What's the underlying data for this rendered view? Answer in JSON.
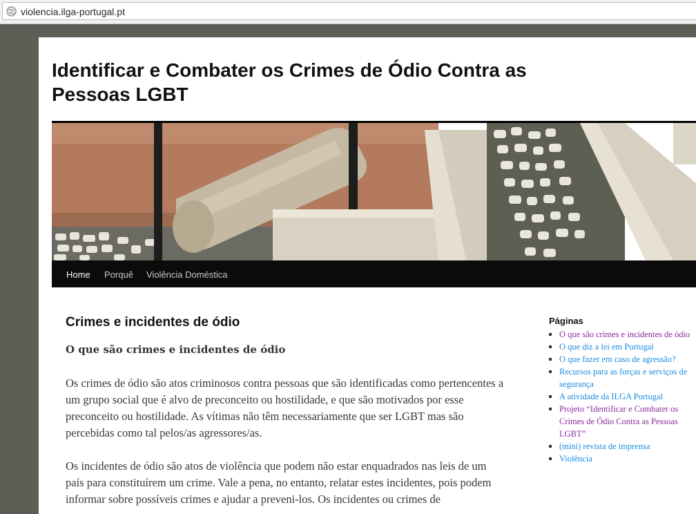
{
  "browser": {
    "url": "violencia.ilga-portugal.pt"
  },
  "site": {
    "title": "Identificar e Combater os Crimes de Ódio Contra as Pessoas LGBT"
  },
  "nav": {
    "items": [
      {
        "label": "Home",
        "active": true
      },
      {
        "label": "Porquê",
        "active": false
      },
      {
        "label": "Violência Doméstica",
        "active": false
      }
    ]
  },
  "post": {
    "title": "Crimes e incidentes de ódio",
    "subheading": "O que são crimes e incidentes de ódio",
    "paragraphs": [
      "Os crimes de ódio são atos criminosos contra pessoas que são identificadas como pertencentes a um grupo social que é alvo de preconceito ou hostilidade, e que são motivados por esse preconceito ou hostilidade. As vítimas não têm necessariamente que ser LGBT mas são percebidas como tal pelos/as agressores/as.",
      "Os incidentes de ódio são atos de violência que podem não estar enquadrados nas leis de um país para constituírem um crime. Vale a pena, no entanto, relatar estes incidentes, pois podem informar sobre possíveis crimes e ajudar a preveni-los. Os incidentes ou crimes de"
    ]
  },
  "sidebar": {
    "widget_title": "Páginas",
    "pages": [
      {
        "label": "O que são crimes e incidentes de ódio",
        "visited": true
      },
      {
        "label": "O que diz a lei em Portugal",
        "visited": false
      },
      {
        "label": "O que fazer em caso de agressão?",
        "visited": false
      },
      {
        "label": "Recursos para as forças e serviços de segurança",
        "visited": false
      },
      {
        "label": "A atividade da ILGA Portugal",
        "visited": false
      },
      {
        "label": "Projeto “Identificar e Combater os Crimes de Ódio Contra as Pessoas LGBT”",
        "visited": true
      },
      {
        "label": "(mini) revista de imprensa",
        "visited": false
      },
      {
        "label": "Violência",
        "visited": false
      }
    ]
  },
  "colors": {
    "link": "#1b8be0",
    "visited_link": "#8a2a9c",
    "nav_bg": "#0b0b0b",
    "page_bg": "#5d5f57"
  }
}
